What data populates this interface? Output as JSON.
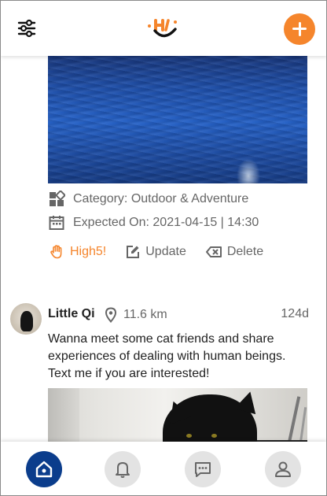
{
  "colors": {
    "accent": "#F5852C",
    "nav_active": "#0B3D8C",
    "nav_inactive": "#E3E3E3",
    "text_muted": "#666666"
  },
  "header": {
    "filter_icon": "sliders-icon",
    "logo_icon": "high5-logo-icon",
    "add_icon": "plus-icon"
  },
  "activity": {
    "category": "Category: Outdoor & Adventure",
    "expected": "Expected On: 2021-04-15 | 14:30",
    "actions": {
      "high5": "High5!",
      "update": "Update",
      "delete": "Delete"
    }
  },
  "post": {
    "username": "Little Qi",
    "distance": "11.6 km",
    "age": "124d",
    "text": "Wanna meet some cat friends and share experiences of dealing with human beings. Text me if you are interested!"
  },
  "bottom_nav": {
    "items": [
      {
        "icon": "home-icon",
        "active": true
      },
      {
        "icon": "bell-icon",
        "active": false
      },
      {
        "icon": "chat-icon",
        "active": false
      },
      {
        "icon": "profile-icon",
        "active": false
      }
    ]
  }
}
